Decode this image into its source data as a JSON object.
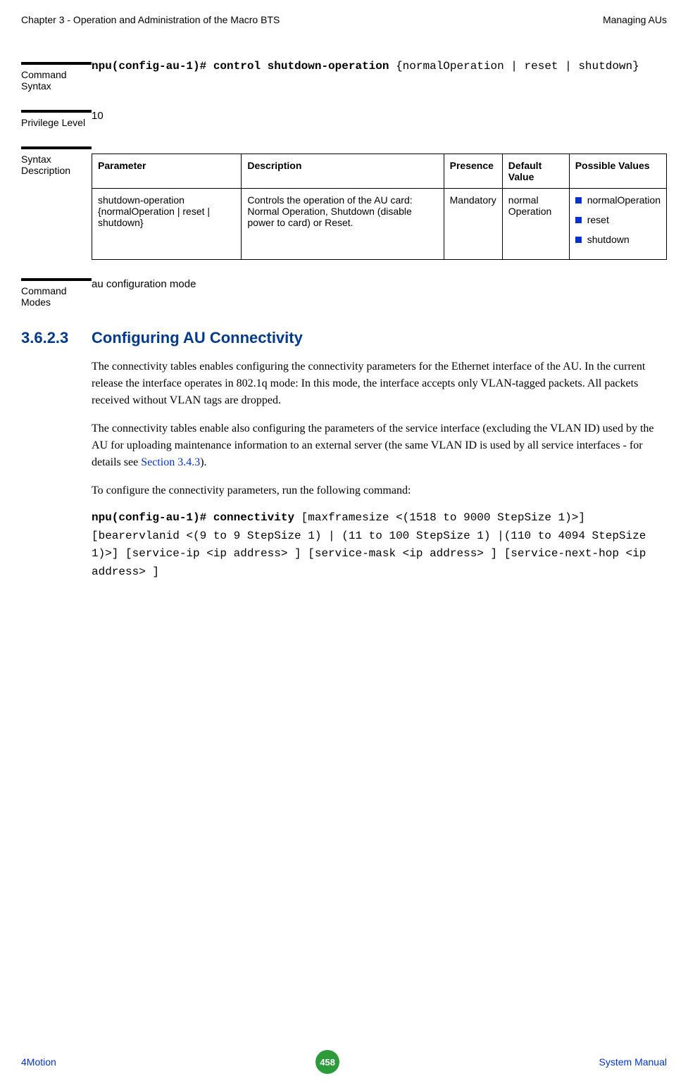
{
  "header": {
    "left": "Chapter 3 - Operation and Administration of the Macro BTS",
    "right": "Managing AUs"
  },
  "rows": {
    "command_syntax": {
      "label": "Command Syntax",
      "prefix": "npu(config-au-1)# control shutdown-operation ",
      "rest": "{normalOperation | reset | shutdown}"
    },
    "privilege": {
      "label": "Privilege Level",
      "value": "10"
    },
    "syntax_desc": {
      "label": "Syntax Description",
      "headers": {
        "param": "Parameter",
        "desc": "Description",
        "presence": "Presence",
        "default": "Default Value",
        "possible": "Possible Values"
      },
      "row": {
        "param": "shutdown-operation {normalOperation | reset | shutdown}",
        "desc": "Controls the operation of the AU card: Normal Operation, Shutdown (disable power to card) or Reset.",
        "presence": "Mandatory",
        "default": "normal Operation",
        "values": {
          "v0": "normalOperation",
          "v1": "reset",
          "v2": "shutdown"
        }
      }
    },
    "command_modes": {
      "label": "Command Modes",
      "value": "au configuration mode"
    }
  },
  "section": {
    "num": "3.6.2.3",
    "title": "Configuring AU Connectivity",
    "p1": "The connectivity tables enables configuring the connectivity parameters for the Ethernet interface of the AU. In the current release the interface operates in 802.1q mode: In this mode, the interface accepts only VLAN-tagged packets. All packets received without VLAN tags are dropped.",
    "p2a": "The connectivity tables enable also configuring the parameters of the service interface (excluding the VLAN ID) used by the AU for uploading maintenance information to an external server (the same VLAN ID is used by all service interfaces - for details see ",
    "p2link": "Section 3.4.3",
    "p2b": ").",
    "p3": "To configure the connectivity parameters, run the following command:",
    "cmd_prefix": "npu(config-au-1)# connectivity ",
    "cmd_rest": "[maxframesize <(1518 to 9000 StepSize 1)>] [bearervlanid <(9 to 9 StepSize 1) | (11 to 100 StepSize 1) |(110 to 4094 StepSize 1)>] [service-ip <ip address> ] [service-mask <ip address> ] [service-next-hop <ip address> ]"
  },
  "footer": {
    "left": "4Motion",
    "page": "458",
    "right": "System Manual"
  }
}
